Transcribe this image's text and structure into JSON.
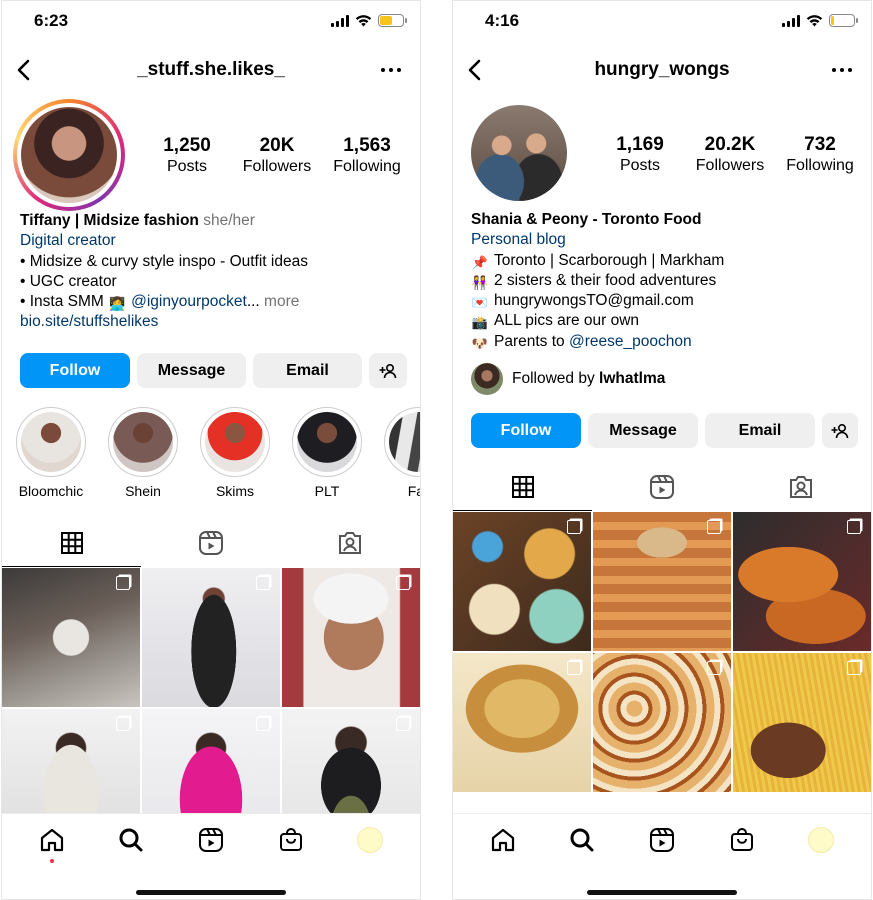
{
  "left": {
    "status": {
      "time": "6:23",
      "battery_level": 0.55,
      "battery_color": "#f5c518"
    },
    "header": {
      "handle": "_stuff.she.likes_"
    },
    "stats": [
      {
        "num": "1,250",
        "label": "Posts"
      },
      {
        "num": "20K",
        "label": "Followers"
      },
      {
        "num": "1,563",
        "label": "Following"
      }
    ],
    "bio": {
      "name": "Tiffany | Midsize fashion",
      "pronouns": "she/her",
      "category": "Digital creator",
      "lines": [
        "• Midsize & curvy style inspo - Outfit ideas",
        "• UGC creator"
      ],
      "smm_prefix": "• Insta SMM",
      "smm_emoji": "woman-technologist-emoji",
      "smm_mention": "@iginyourpocket",
      "ellipsis": "...",
      "more": "more",
      "link": "bio.site/stuffshelikes"
    },
    "buttons": {
      "follow": "Follow",
      "message": "Message",
      "email": "Email",
      "add_icon": "add-person-icon"
    },
    "highlights": [
      "Bloomchic",
      "Shein",
      "Skims",
      "PLT",
      "Fall"
    ],
    "tabs": [
      "grid-icon",
      "reels-icon",
      "tagged-icon"
    ]
  },
  "right": {
    "status": {
      "time": "4:16",
      "battery_level": 0.15,
      "battery_color": "#f5c518"
    },
    "header": {
      "handle": "hungry_wongs"
    },
    "stats": [
      {
        "num": "1,169",
        "label": "Posts"
      },
      {
        "num": "20.2K",
        "label": "Followers"
      },
      {
        "num": "732",
        "label": "Following"
      }
    ],
    "bio": {
      "name": "Shania & Peony - Toronto Food",
      "category": "Personal blog",
      "lines": [
        {
          "emoji": "pushpin-emoji",
          "text": "Toronto | Scarborough | Markham"
        },
        {
          "emoji": "women-emoji",
          "text": "2 sisters & their food adventures"
        },
        {
          "emoji": "love-letter-emoji",
          "text": "hungrywongsTO@gmail.com"
        },
        {
          "emoji": "camera-flash-emoji",
          "text": "ALL pics are our own"
        }
      ],
      "parents_emoji": "dog-face-emoji",
      "parents_prefix": "Parents to",
      "parents_mention": "@reese_poochon"
    },
    "followed_by": {
      "prefix": "Followed by",
      "user": "lwhatlma"
    },
    "buttons": {
      "follow": "Follow",
      "message": "Message",
      "email": "Email",
      "add_icon": "add-person-icon"
    },
    "tabs": [
      "grid-icon",
      "reels-icon",
      "tagged-icon"
    ]
  },
  "bottom_nav": [
    "home-icon",
    "search-icon",
    "reels-icon",
    "shop-icon",
    "profile-avatar"
  ],
  "colors": {
    "accent": "#0095f6",
    "link": "#00376b",
    "secondary_text": "#737373",
    "notification_dot": "#ff3040"
  }
}
